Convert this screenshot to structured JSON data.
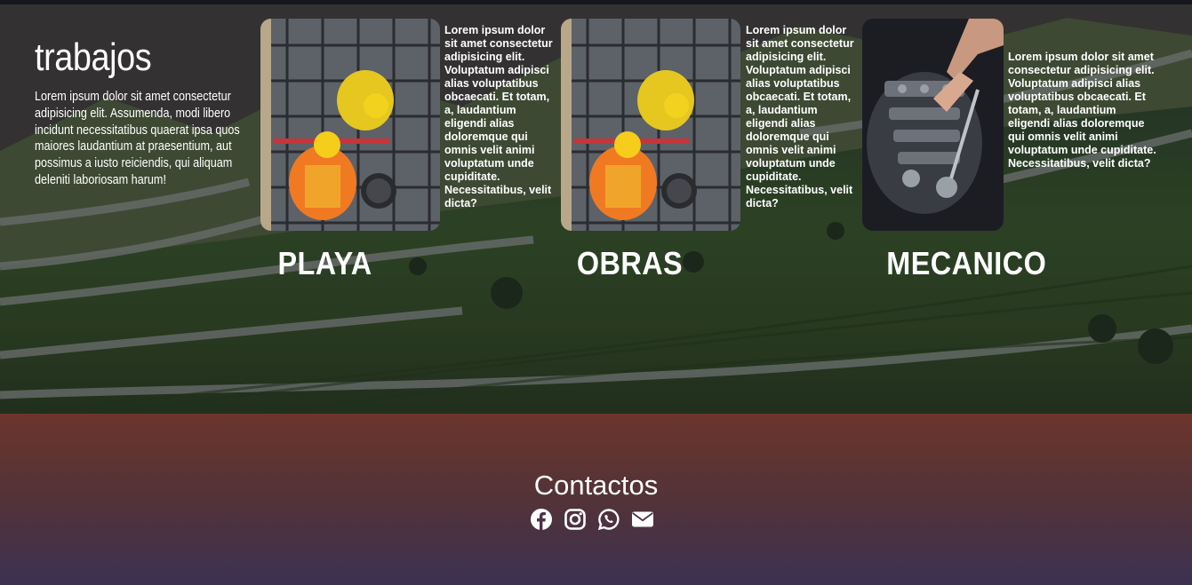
{
  "hero": {
    "title": "trabajos",
    "description": "Lorem ipsum dolor sit amet consectetur adipisicing elit. Assumenda, modi libero incidunt necessitatibus quaerat ipsa quos maiores laudantium at praesentium, aut possimus a iusto reiciendis, qui aliquam deleniti laboriosam harum!"
  },
  "cards": [
    {
      "title": "PLAYA",
      "text": "Lorem ipsum dolor sit amet consectetur adipisicing elit. Voluptatum adipisci alias voluptatibus obcaecati. Et totam, a, laudantium eligendi alias doloremque qui omnis velit animi voluptatum unde cupiditate. Necessitatibus, velit dicta?",
      "image": "construction-workers-photo"
    },
    {
      "title": "OBRAS",
      "text": "Lorem ipsum dolor sit amet consectetur adipisicing elit. Voluptatum adipisci alias voluptatibus obcaecati. Et totam, a, laudantium eligendi alias doloremque qui omnis velit animi voluptatum unde cupiditate. Necessitatibus, velit dicta?",
      "image": "construction-workers-photo"
    },
    {
      "title": "MECANICO",
      "text": "Lorem ipsum dolor sit amet consectetur adipisicing elit. Voluptatum adipisci alias voluptatibus obcaecati. Et totam, a, laudantium eligendi alias doloremque qui omnis velit animi voluptatum unde cupiditate. Necessitatibus, velit dicta?",
      "image": "car-engine-mechanic-photo"
    }
  ],
  "footer": {
    "title": "Contactos",
    "icons": [
      "facebook-icon",
      "instagram-icon",
      "whatsapp-icon",
      "envelope-icon"
    ]
  },
  "colors": {
    "footer_top": "#6c352c",
    "footer_bottom": "#3c3152",
    "text": "#ffffff"
  }
}
